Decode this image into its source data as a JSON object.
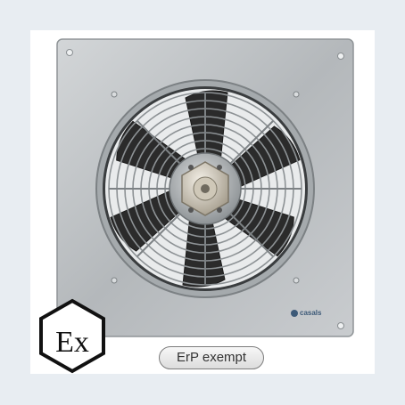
{
  "badge": {
    "text": "ErP exempt"
  },
  "brand": {
    "text": "casals"
  },
  "ex_mark": {
    "text": "Ex"
  },
  "colors": {
    "plate": "#b9bcbe",
    "blade": "#2e2e2e",
    "guard": "#8d9295",
    "background": "#eaeef3"
  },
  "icons": [
    "atex-ex-hexagon-icon",
    "brand-logo-icon"
  ]
}
